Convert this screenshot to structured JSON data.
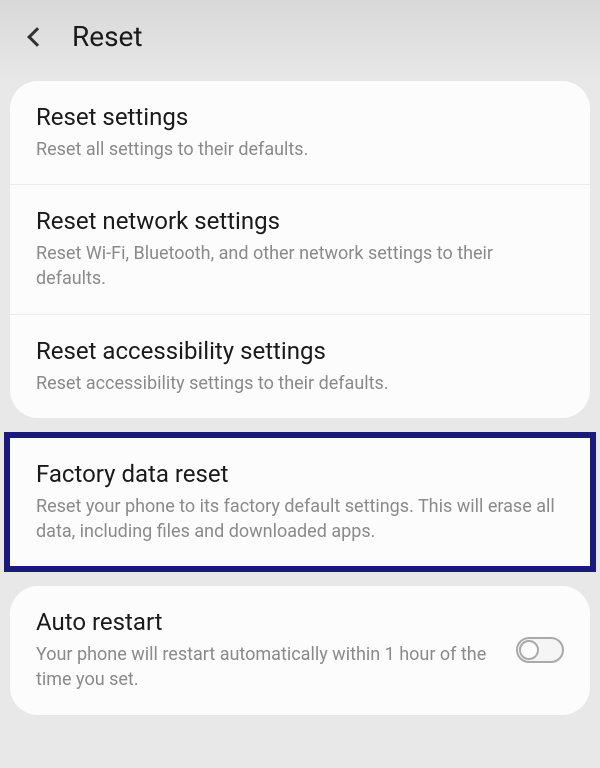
{
  "header": {
    "title": "Reset"
  },
  "items": {
    "resetSettings": {
      "title": "Reset settings",
      "desc": "Reset all settings to their defaults."
    },
    "resetNetwork": {
      "title": "Reset network settings",
      "desc": "Reset Wi-Fi, Bluetooth, and other network settings to their defaults."
    },
    "resetAccessibility": {
      "title": "Reset accessibility settings",
      "desc": "Reset accessibility settings to their defaults."
    },
    "factoryReset": {
      "title": "Factory data reset",
      "desc": "Reset your phone to its factory default settings. This will erase all data, including files and downloaded apps."
    },
    "autoRestart": {
      "title": "Auto restart",
      "desc": "Your phone will restart automatically within 1 hour of the time you set."
    }
  }
}
